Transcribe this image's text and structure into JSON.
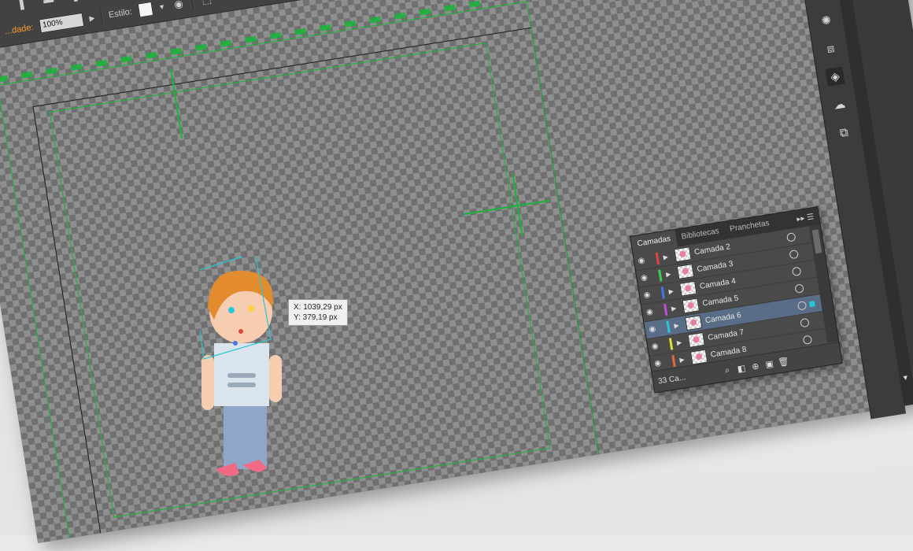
{
  "toolbar": {
    "opacity_label": "...dade:",
    "opacity_value": "100%",
    "style_label": "Estilo:"
  },
  "tooltip": {
    "x": "X: 1039,29 px",
    "y": "Y: 379,19 px"
  },
  "layers_panel": {
    "tabs": [
      "Camadas",
      "Bibliotecas",
      "Pranchetas"
    ],
    "layers": [
      {
        "name": "Camada 2",
        "color": "#e0463c",
        "selected": false
      },
      {
        "name": "Camada 3",
        "color": "#3fcc55",
        "selected": false
      },
      {
        "name": "Camada 4",
        "color": "#3f7ae0",
        "selected": false
      },
      {
        "name": "Camada 5",
        "color": "#c04fd6",
        "selected": false
      },
      {
        "name": "Camada 6",
        "color": "#27c7d8",
        "selected": true
      },
      {
        "name": "Camada 7",
        "color": "#e0e03c",
        "selected": false
      },
      {
        "name": "Camada 8",
        "color": "#e06a3c",
        "selected": false
      }
    ],
    "layer_count": "33 Ca..."
  },
  "colors": {
    "guide": "#19b53a",
    "selection": "#27c7d8"
  }
}
